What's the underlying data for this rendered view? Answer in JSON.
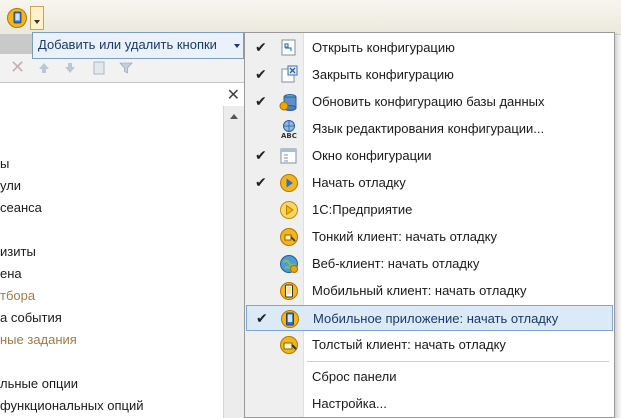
{
  "toolbar": {
    "icon": "run-app-icon",
    "dropdown": "chevron-down-icon"
  },
  "submenu_header": {
    "label": "Добавить или удалить кнопки"
  },
  "background_tree": {
    "items": [
      {
        "text": "ы",
        "muted": false
      },
      {
        "text": "ули",
        "muted": false
      },
      {
        "text": "сеанса",
        "muted": false
      },
      {
        "text": "изиты",
        "muted": false
      },
      {
        "text": "ена",
        "muted": false
      },
      {
        "text": "тбора",
        "muted": true
      },
      {
        "text": "а события",
        "muted": false
      },
      {
        "text": "ные задания",
        "muted": true
      },
      {
        "text": "льные опции",
        "muted": false
      },
      {
        "text": "функциональных опций",
        "muted": false
      }
    ]
  },
  "menu": {
    "items": [
      {
        "label": "Открыть конфигурацию",
        "checked": true,
        "icon": "open-config-icon"
      },
      {
        "label": "Закрыть конфигурацию",
        "checked": true,
        "icon": "close-config-icon"
      },
      {
        "label": "Обновить конфигурацию базы данных",
        "checked": true,
        "icon": "update-db-icon"
      },
      {
        "label": "Язык редактирования конфигурации...",
        "checked": false,
        "icon": "abc-language-icon"
      },
      {
        "label": "Окно конфигурации",
        "checked": true,
        "icon": "config-window-icon"
      },
      {
        "label": "Начать отладку",
        "checked": true,
        "icon": "start-debug-icon"
      },
      {
        "label": "1С:Предприятие",
        "checked": false,
        "icon": "enterprise-icon"
      },
      {
        "label": "Тонкий клиент: начать отладку",
        "checked": false,
        "icon": "thin-client-icon"
      },
      {
        "label": "Веб-клиент: начать отладку",
        "checked": false,
        "icon": "web-client-icon"
      },
      {
        "label": "Мобильный клиент: начать отладку",
        "checked": false,
        "icon": "mobile-client-icon"
      },
      {
        "label": "Мобильное приложение: начать отладку",
        "checked": true,
        "icon": "mobile-app-icon",
        "selected": true
      },
      {
        "label": "Толстый клиент: начать отладку",
        "checked": false,
        "icon": "thick-client-icon"
      }
    ],
    "reset_label": "Сброс панели",
    "settings_label": "Настройка..."
  },
  "colors": {
    "highlight": "#dce9f7",
    "highlight_border": "#7ea6d8",
    "orange_icon": "#f2a400"
  }
}
